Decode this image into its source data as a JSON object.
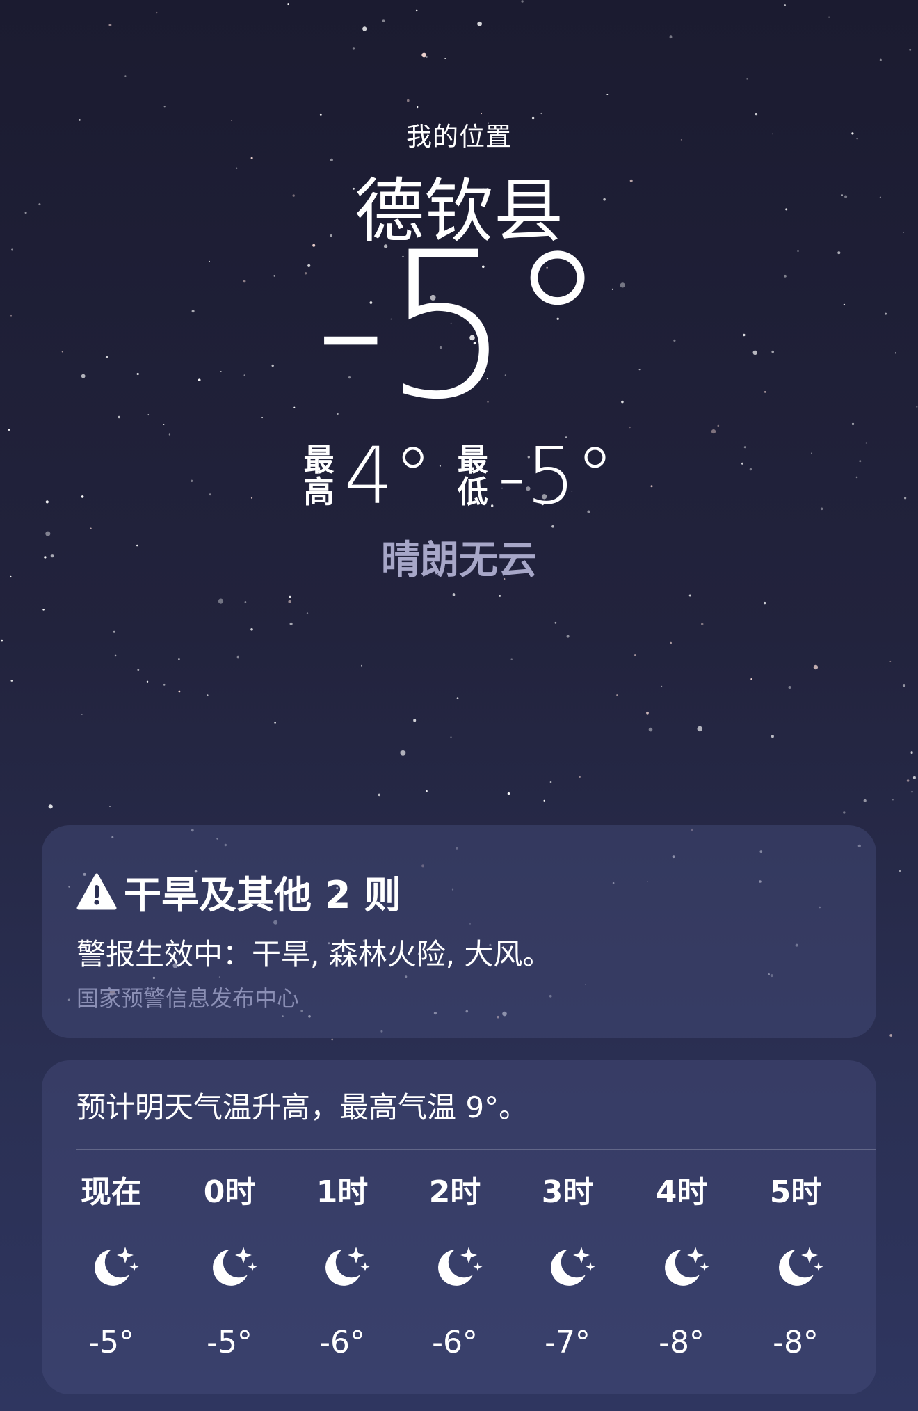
{
  "header": {
    "location_label": "我的位置",
    "city": "德钦县",
    "current_temp": "-5°",
    "high_label": "最高",
    "high_temp": "4°",
    "low_label": "最低",
    "low_temp": "-5°",
    "condition": "晴朗无云"
  },
  "alert": {
    "icon": "warning-triangle-icon",
    "title": "干旱及其他 2 则",
    "body": "警报生效中：干旱, 森林火险, 大风。",
    "source": "国家预警信息发布中心"
  },
  "hourly": {
    "summary": "预计明天气温升高，最高气温 9°。",
    "items": [
      {
        "label": "现在",
        "icon": "moon-stars-icon",
        "temp": "-5°"
      },
      {
        "label": "0时",
        "icon": "moon-stars-icon",
        "temp": "-5°"
      },
      {
        "label": "1时",
        "icon": "moon-stars-icon",
        "temp": "-6°"
      },
      {
        "label": "2时",
        "icon": "moon-stars-icon",
        "temp": "-6°"
      },
      {
        "label": "3时",
        "icon": "moon-stars-icon",
        "temp": "-7°"
      },
      {
        "label": "4时",
        "icon": "moon-stars-icon",
        "temp": "-8°"
      },
      {
        "label": "5时",
        "icon": "moon-stars-icon",
        "temp": "-8°"
      }
    ]
  },
  "colors": {
    "background_top": "#1b1b30",
    "background_bottom": "#2f3660",
    "condition_text": "#a7a7c8",
    "source_text": "#8b8fb5"
  }
}
